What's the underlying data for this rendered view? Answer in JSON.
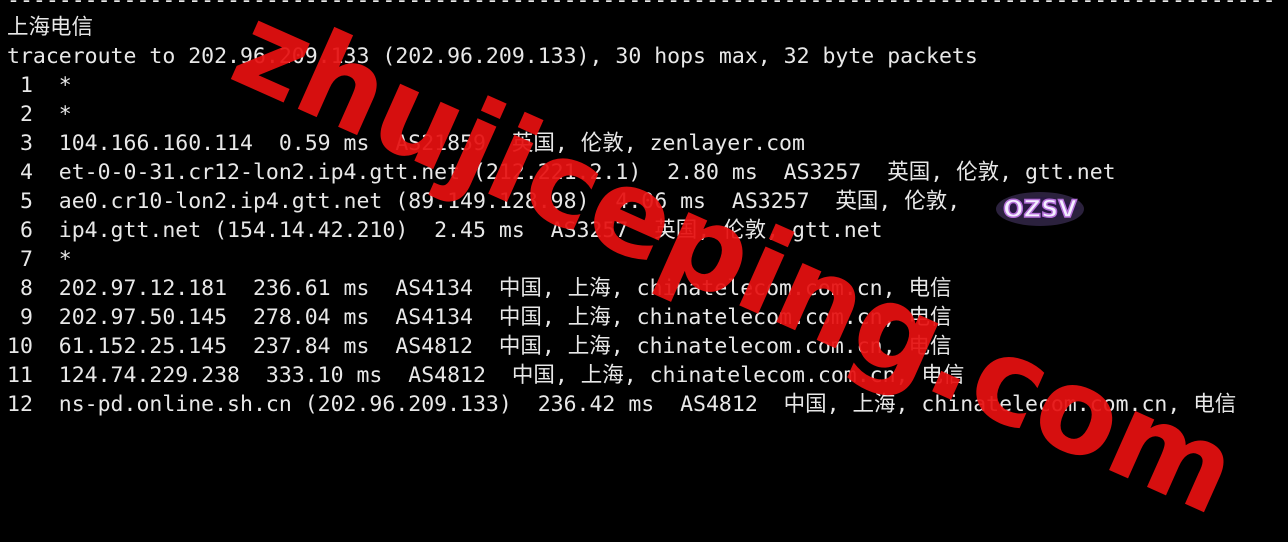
{
  "terminal": {
    "divider": "--------------------------------------------------------------------------------------------------",
    "lines": [
      "上海电信",
      "traceroute to 202.96.209.133 (202.96.209.133), 30 hops max, 32 byte packets",
      " 1  *",
      " 2  *",
      " 3  104.166.160.114  0.59 ms  AS21859  英国, 伦敦, zenlayer.com",
      " 4  et-0-0-31.cr12-lon2.ip4.gtt.net (212.221.2.1)  2.80 ms  AS3257  英国, 伦敦, gtt.net",
      " 5  ae0.cr10-lon2.ip4.gtt.net (89.149.128.98)  4.06 ms  AS3257  英国, 伦敦,",
      " 6  ip4.gtt.net (154.14.42.210)  2.45 ms  AS3257  英国, 伦敦, gtt.net",
      " 7  *",
      " 8  202.97.12.181  236.61 ms  AS4134  中国, 上海, chinatelecom.com.cn, 电信",
      " 9  202.97.50.145  278.04 ms  AS4134  中国, 上海, chinatelecom.com.cn, 电信",
      "10  61.152.25.145  237.84 ms  AS4812  中国, 上海, chinatelecom.com.cn, 电信",
      "11  124.74.229.238  333.10 ms  AS4812  中国, 上海, chinatelecom.com.cn, 电信",
      "12  ns-pd.online.sh.cn (202.96.209.133)  236.42 ms  AS4812  中国, 上海, chinatelecom.com.cn, 电信"
    ]
  },
  "watermark": {
    "text": "zhujiceping.com",
    "color": "#e61010"
  },
  "logo": {
    "text": "OZSV",
    "icon": "ozsv-logo-icon"
  },
  "colors": {
    "background": "#000000",
    "text": "#e8e8e8"
  }
}
